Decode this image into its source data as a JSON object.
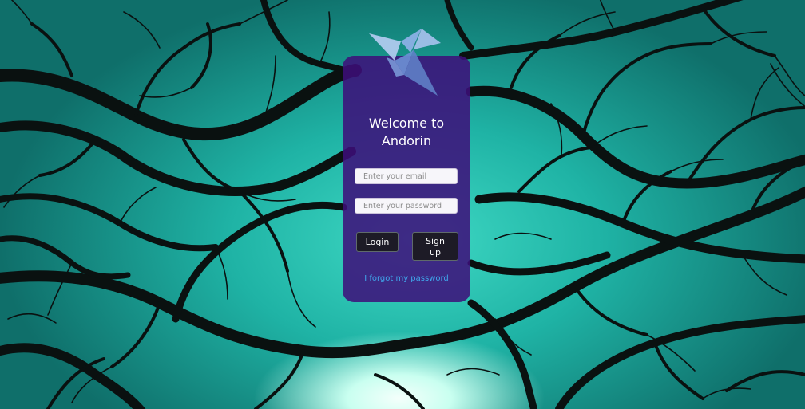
{
  "background": {
    "image": "tree-branches-silhouette-against-teal-sky"
  },
  "logo": {
    "icon": "origami-crane-icon",
    "colors": [
      "#8fb1e8",
      "#5f7fc6",
      "#b6cdf3"
    ]
  },
  "login_card": {
    "title": "Welcome to Andorin",
    "email_placeholder": "Enter your email",
    "password_placeholder": "Enter your password",
    "login_label": "Login",
    "signup_label": "Sign up",
    "forgot_label": "I forgot my password"
  },
  "colors": {
    "card": "#3e0e7a",
    "link": "#40a7ec",
    "button": "#191919",
    "teal": "#20c6b2"
  }
}
